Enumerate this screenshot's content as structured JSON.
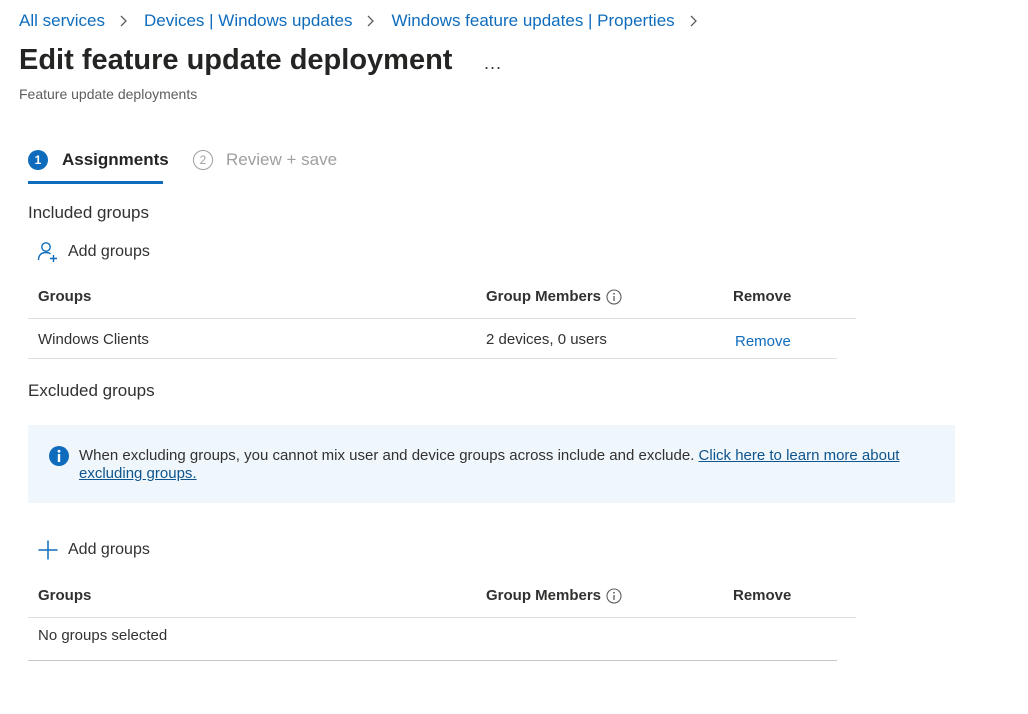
{
  "breadcrumb": [
    {
      "label": "All services"
    },
    {
      "label": "Devices | Windows updates"
    },
    {
      "label": "Windows feature updates | Properties"
    }
  ],
  "page": {
    "title": "Edit feature update deployment",
    "more": "...",
    "subtitle": "Feature update deployments"
  },
  "steps": [
    {
      "number": "1",
      "label": "Assignments",
      "state": "active"
    },
    {
      "number": "2",
      "label": "Review + save",
      "state": "inactive"
    }
  ],
  "included": {
    "heading": "Included groups",
    "add_label": "Add groups",
    "columns": [
      "Groups",
      "Group Members",
      "Remove"
    ],
    "rows": [
      {
        "group": "Windows Clients",
        "members": "2 devices, 0 users",
        "remove": "Remove"
      }
    ]
  },
  "excluded": {
    "heading": "Excluded groups",
    "banner_text": "When excluding groups, you cannot mix user and device groups across include and exclude. ",
    "banner_link": "Click here to learn more about excluding groups.",
    "add_label": "Add groups",
    "columns": [
      "Groups",
      "Group Members",
      "Remove"
    ],
    "empty_text": "No groups selected"
  },
  "colors": {
    "accent": "#0f6cbd",
    "banner_bg": "#eff6fc",
    "info_icon": "#0f6cbd"
  },
  "icons": {
    "breadcrumb_separator": "chevron-right-icon",
    "include_add": "add-person-icon",
    "exclude_add": "plus-icon",
    "column_info": "info-outline-icon",
    "banner": "info-filled-icon"
  }
}
